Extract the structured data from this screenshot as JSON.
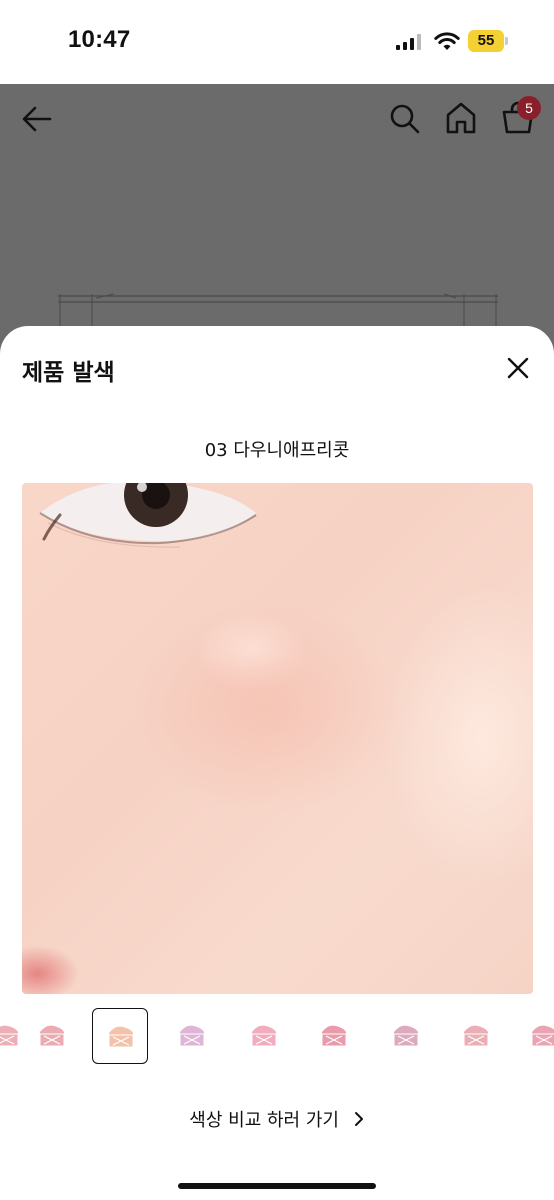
{
  "status_bar": {
    "time": "10:47",
    "battery": "55"
  },
  "nav": {
    "cart_count": "5"
  },
  "sheet": {
    "title": "제품 발색",
    "shade_name": "03 다우니애프리콧",
    "compare_label": "색상 비교 하러 가기"
  },
  "thumbnails": [
    {
      "color": "#e9a1a8"
    },
    {
      "color": "#e79da3"
    },
    {
      "color": "#f0b79a",
      "selected": true
    },
    {
      "color": "#d9a7cf"
    },
    {
      "color": "#ee9db2"
    },
    {
      "color": "#e58a9b"
    },
    {
      "color": "#d79ab0"
    },
    {
      "color": "#e8a0a8"
    },
    {
      "color": "#e693a6"
    }
  ],
  "colors": {
    "accent_badge": "#8a1f2c",
    "overlay": "#6b6b6b"
  }
}
